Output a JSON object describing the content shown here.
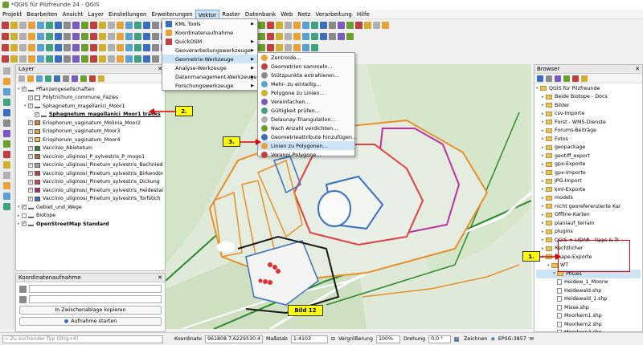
{
  "window": {
    "title": "*QGIS für Pilzfreunde 24 - QGIS"
  },
  "menu": [
    "Projekt",
    "Bearbeiten",
    "Ansicht",
    "Layer",
    "Einstellungen",
    "Erweiterungen",
    "Vektor",
    "Raster",
    "Datenbank",
    "Web",
    "Netz",
    "Verarbeitung",
    "Hilfe"
  ],
  "vektor_menu": [
    {
      "label": "KML Tools",
      "sub": true
    },
    {
      "label": "Koordinatenaufnahme",
      "sub": false
    },
    {
      "label": "QuickOSM",
      "sub": true
    },
    {
      "label": "Geoverarbeitungswerkzeuge",
      "sub": true
    },
    {
      "label": "Geometrie-Werkzeuge",
      "sub": true
    },
    {
      "label": "Analyse-Werkzeuge",
      "sub": true
    },
    {
      "label": "Datenmanagement-Werkzeuge",
      "sub": true
    },
    {
      "label": "Forschungswerkzeuge",
      "sub": true
    }
  ],
  "geometry_menu": [
    "Zentroide...",
    "Geometrien sammeln...",
    "Stützpunkte extrahieren...",
    "Mehr- zu einteilig...",
    "Polygone zu Linien...",
    "Vereinfachen...",
    "Gültigkeit prüfen...",
    "Delaunay-Triangulation...",
    "Nach Anzahl verdichten...",
    "Geometrieattribute hinzufügen...",
    "Linien zu Polygonen...",
    "Voronoi-Polygone..."
  ],
  "layer_panel": {
    "title": "Layer",
    "layers": [
      {
        "label": "Pflanzengesellschaften",
        "indent": 0,
        "checked": true,
        "swatch": "",
        "bold": false
      },
      {
        "label": "Polytrichum_commune_Fazies",
        "indent": 1,
        "checked": true,
        "swatch": "#ffffff",
        "bold": false
      },
      {
        "label": "Sphagnetum_magellanici_Moor1",
        "indent": 1,
        "checked": true,
        "swatch": "",
        "bold": false
      },
      {
        "label": "Sphagnetum_magellanici_Moor1 tracks",
        "indent": 2,
        "checked": true,
        "swatch": "",
        "bold": true
      },
      {
        "label": "Eriophorum_vaginatum_Molinia_Moor2",
        "indent": 1,
        "checked": true,
        "swatch": "#e37a2c",
        "bold": false
      },
      {
        "label": "Eriophorum_vaginatum_Moor3",
        "indent": 1,
        "checked": true,
        "swatch": "#e8a23a",
        "bold": false
      },
      {
        "label": "Eriophorum_vaginatum_Moor4",
        "indent": 1,
        "checked": true,
        "swatch": "#f0c040",
        "bold": false
      },
      {
        "label": "Vaccinio_Abietetum",
        "indent": 1,
        "checked": true,
        "swatch": "#2e8a2e",
        "bold": false
      },
      {
        "label": "Vaccinio_uliginosi_P_sylvestris_P_mugo1",
        "indent": 1,
        "checked": true,
        "swatch": "#b07030",
        "bold": false
      },
      {
        "label": "Vaccinio_uliginosi_Pinetum_sylvestris_Bachniederung",
        "indent": 1,
        "checked": true,
        "swatch": "#a0a0a0",
        "bold": false
      },
      {
        "label": "Vaccinio_uliginosi_Pinetum_sylvestris_Birkendomina",
        "indent": 1,
        "checked": true,
        "swatch": "#c04040",
        "bold": false
      },
      {
        "label": "Vaccinio_uliginosi_Pinetum_sylvestris_Dickung",
        "indent": 1,
        "checked": true,
        "swatch": "#d04a4a",
        "bold": false
      },
      {
        "label": "Vaccinio_uliginosi_Pinetum_sylvestris_Heidestadium",
        "indent": 1,
        "checked": true,
        "swatch": "#c02090",
        "bold": false
      },
      {
        "label": "Vaccinio_uliginosi_Pinetum_sylvestris_Torfstich",
        "indent": 1,
        "checked": true,
        "swatch": "#3a6fbf",
        "bold": false
      },
      {
        "label": "Gebiet_und_Wege",
        "indent": 0,
        "checked": true,
        "swatch": "",
        "bold": false
      },
      {
        "label": "Biotope",
        "indent": 0,
        "checked": false,
        "swatch": "",
        "bold": false
      },
      {
        "label": "OpenStreetMap Standard",
        "indent": 0,
        "checked": true,
        "swatch": "",
        "bold": true
      }
    ]
  },
  "coord_panel": {
    "title": "Koordinatenaufnahme",
    "copy_button": "In Zwischenablage kopieren",
    "start_button": "Aufnahme starten"
  },
  "browser_panel": {
    "title": "Browser",
    "items": [
      {
        "label": "QGIS für Pilzfreunde",
        "type": "folder",
        "indent": 0
      },
      {
        "label": "Beide Biotope - Docs",
        "type": "folder",
        "indent": 1
      },
      {
        "label": "Bilder",
        "type": "folder",
        "indent": 1
      },
      {
        "label": "csv-Importe",
        "type": "folder",
        "indent": 1
      },
      {
        "label": "Forst - WMS-Dienste",
        "type": "folder",
        "indent": 1
      },
      {
        "label": "Forums-Beiträge",
        "type": "folder",
        "indent": 1
      },
      {
        "label": "Fotos",
        "type": "folder",
        "indent": 1
      },
      {
        "label": "geopackage",
        "type": "folder",
        "indent": 1
      },
      {
        "label": "geotiff_export",
        "type": "folder",
        "indent": 1
      },
      {
        "label": "gpx-Exporte",
        "type": "folder",
        "indent": 1
      },
      {
        "label": "gpx-Importe",
        "type": "folder",
        "indent": 1
      },
      {
        "label": "JPG-Import",
        "type": "folder",
        "indent": 1
      },
      {
        "label": "kml-Exporte",
        "type": "folder",
        "indent": 1
      },
      {
        "label": "models",
        "type": "folder",
        "indent": 1
      },
      {
        "label": "nicht georeferenzierte Kar",
        "type": "folder",
        "indent": 1
      },
      {
        "label": "Offline-Karten",
        "type": "folder",
        "indent": 1
      },
      {
        "label": "planlauf_terrain",
        "type": "folder",
        "indent": 1
      },
      {
        "label": "plugins",
        "type": "folder",
        "indent": 1
      },
      {
        "label": "QGIS + LIDAR - tipps & Tr",
        "type": "folder",
        "indent": 1
      },
      {
        "label": "Rechtlicher",
        "type": "folder",
        "indent": 1
      },
      {
        "label": "Shape-Exporte",
        "type": "folder",
        "indent": 1
      },
      {
        "label": "WT",
        "type": "folder",
        "indent": 2
      },
      {
        "label": "PflGes",
        "type": "folder",
        "indent": 3
      },
      {
        "label": "Heidew_1_Moorw",
        "type": "file",
        "indent": 3
      },
      {
        "label": "Heidewald.shp",
        "type": "file",
        "indent": 3
      },
      {
        "label": "Heidewald_1.shp",
        "type": "file",
        "indent": 3
      },
      {
        "label": "Misse.shp",
        "type": "file",
        "indent": 3
      },
      {
        "label": "Moorkern1.shp",
        "type": "file",
        "indent": 3
      },
      {
        "label": "Moorkern2.shp",
        "type": "file",
        "indent": 3
      },
      {
        "label": "Moorkern3.shp",
        "type": "file",
        "indent": 3
      }
    ]
  },
  "callouts": {
    "one": "1.",
    "two": "2.",
    "three": "3.",
    "bild": "Bild 12"
  },
  "status": {
    "search_placeholder": "Zu suchender Typ (Strg+K)",
    "coord_label": "Koordinate",
    "coord_value": "961808.7,6229530.4",
    "scale_label": "Maßstab",
    "scale_value": "1:4103",
    "magnifier_label": "Vergrößerung",
    "magnifier_value": "100%",
    "rotation_label": "Drehung",
    "rotation_value": "0,0 °",
    "render_label": "Zeichnen",
    "crs": "EPSG:3857"
  }
}
